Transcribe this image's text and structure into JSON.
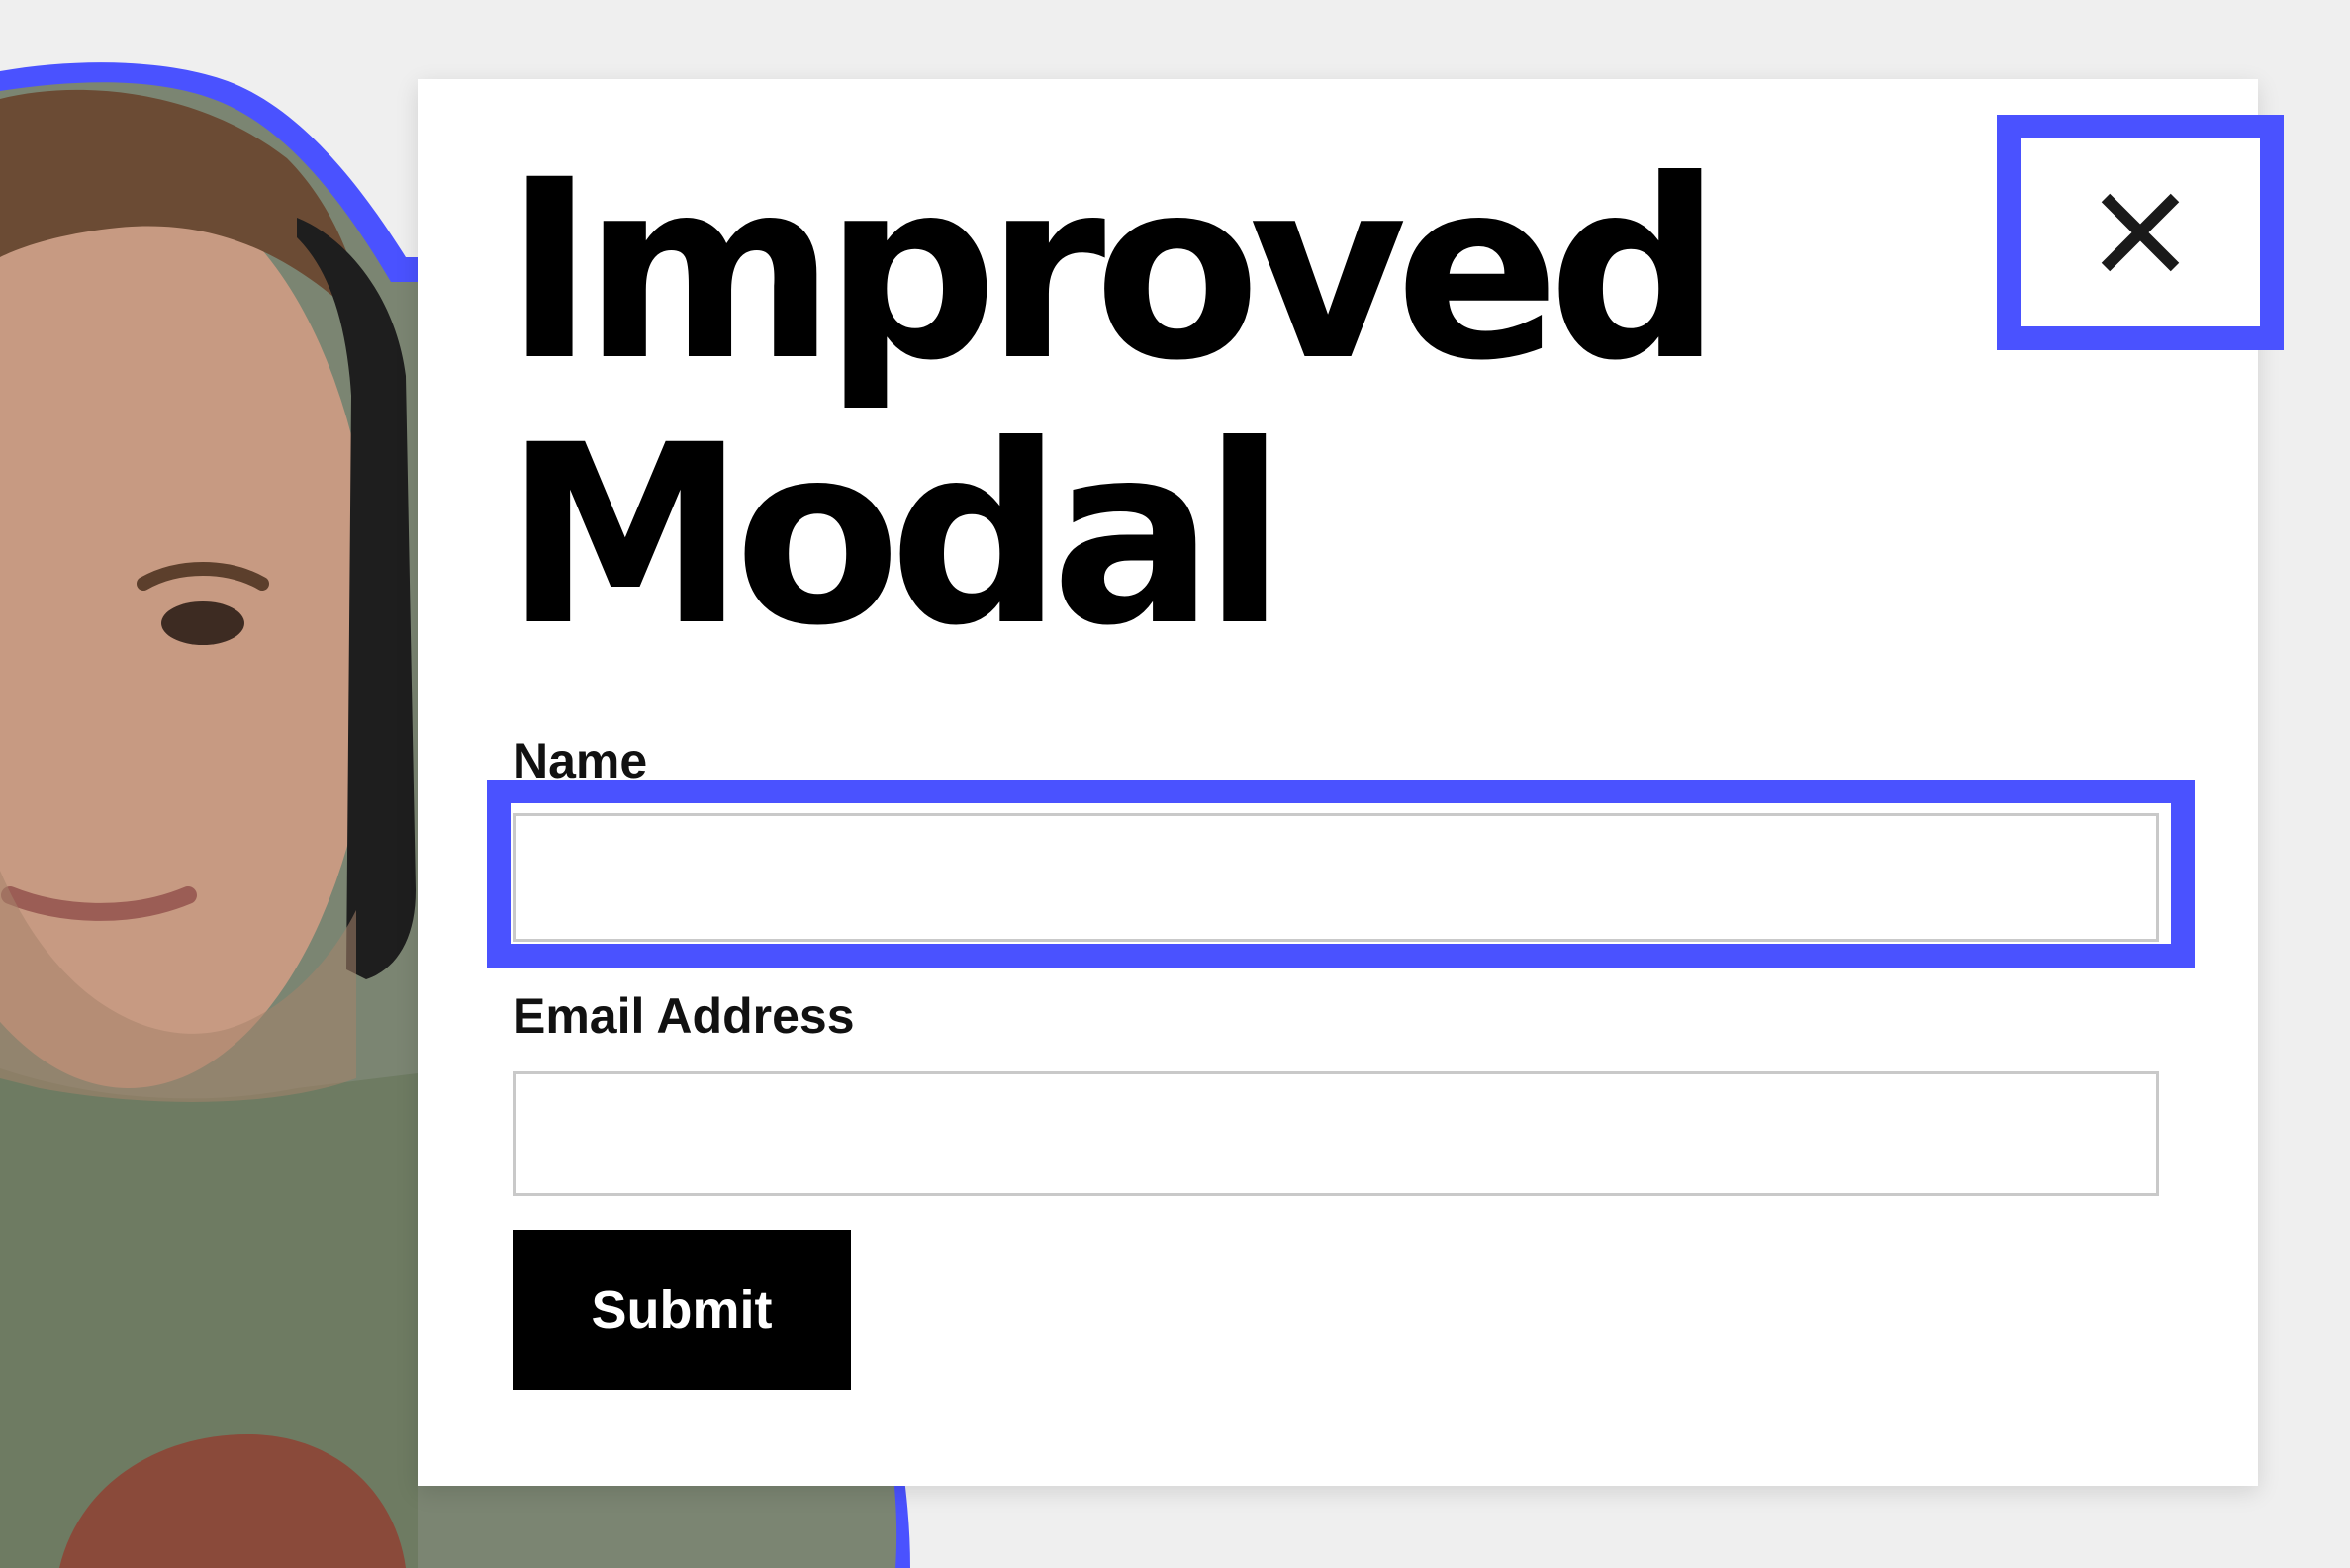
{
  "modal": {
    "title": "Improved\nModal",
    "close_icon": "close-icon",
    "fields": {
      "name": {
        "label": "Name",
        "value": "",
        "placeholder": ""
      },
      "email": {
        "label": "Email Address",
        "value": "",
        "placeholder": ""
      }
    },
    "submit_label": "Submit"
  },
  "colors": {
    "focus_outline": "#4a52ff",
    "button_background": "#000000",
    "page_background": "#efefef"
  }
}
